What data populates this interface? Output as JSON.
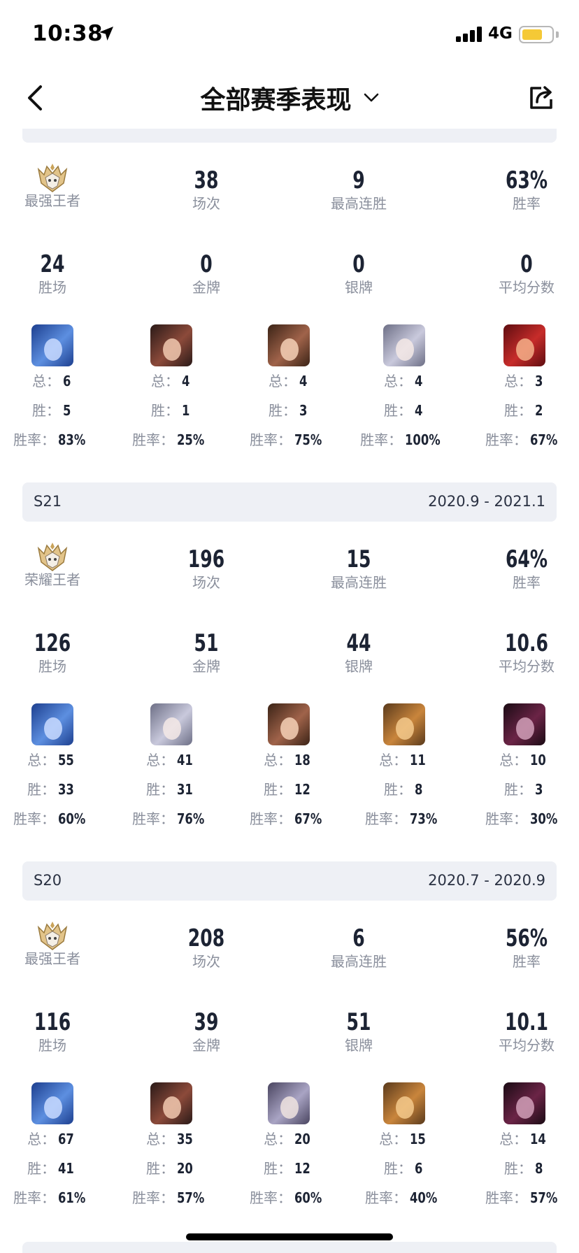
{
  "status_bar": {
    "time": "10:38",
    "network": "4G",
    "battery_level": 0.7
  },
  "nav": {
    "title": "全部赛季表现"
  },
  "seasons": [
    {
      "header": null,
      "rank_label": "最强王者",
      "matches": "38",
      "matches_label": "场次",
      "streak": "9",
      "streak_label": "最高连胜",
      "win_rate": "63%",
      "win_rate_label": "胜率",
      "wins": "24",
      "wins_label": "胜场",
      "gold": "0",
      "gold_label": "金牌",
      "silver": "0",
      "silver_label": "银牌",
      "avg_score": "0",
      "avg_score_label": "平均分数",
      "heroes": [
        {
          "avatar": "blue-hero",
          "total": "6",
          "wins": "5",
          "rate": "83%"
        },
        {
          "avatar": "dark-hair-hero",
          "total": "4",
          "wins": "1",
          "rate": "25%"
        },
        {
          "avatar": "brown-hair-hero",
          "total": "4",
          "wins": "3",
          "rate": "75%"
        },
        {
          "avatar": "silver-hair-hero",
          "total": "4",
          "wins": "4",
          "rate": "100%"
        },
        {
          "avatar": "red-hair-hero",
          "total": "3",
          "wins": "2",
          "rate": "67%"
        }
      ]
    },
    {
      "header": {
        "name": "S21",
        "range": "2020.9 - 2021.1"
      },
      "rank_label": "荣耀王者",
      "matches": "196",
      "matches_label": "场次",
      "streak": "15",
      "streak_label": "最高连胜",
      "win_rate": "64%",
      "win_rate_label": "胜率",
      "wins": "126",
      "wins_label": "胜场",
      "gold": "51",
      "gold_label": "金牌",
      "silver": "44",
      "silver_label": "银牌",
      "avg_score": "10.6",
      "avg_score_label": "平均分数",
      "heroes": [
        {
          "avatar": "blue-hero",
          "total": "55",
          "wins": "33",
          "rate": "60%"
        },
        {
          "avatar": "silver-hair-hero",
          "total": "41",
          "wins": "31",
          "rate": "76%"
        },
        {
          "avatar": "brown-hair-hero",
          "total": "18",
          "wins": "12",
          "rate": "67%"
        },
        {
          "avatar": "goggles-hero",
          "total": "11",
          "wins": "8",
          "rate": "73%"
        },
        {
          "avatar": "demon-hero",
          "total": "10",
          "wins": "3",
          "rate": "30%"
        }
      ]
    },
    {
      "header": {
        "name": "S20",
        "range": "2020.7 - 2020.9"
      },
      "rank_label": "最强王者",
      "matches": "208",
      "matches_label": "场次",
      "streak": "6",
      "streak_label": "最高连胜",
      "win_rate": "56%",
      "win_rate_label": "胜率",
      "wins": "116",
      "wins_label": "胜场",
      "gold": "39",
      "gold_label": "金牌",
      "silver": "51",
      "silver_label": "银牌",
      "avg_score": "10.1",
      "avg_score_label": "平均分数",
      "heroes": [
        {
          "avatar": "blue-hero",
          "total": "67",
          "wins": "41",
          "rate": "61%"
        },
        {
          "avatar": "dark-hair-hero",
          "total": "35",
          "wins": "20",
          "rate": "57%"
        },
        {
          "avatar": "lavender-hair-hero",
          "total": "20",
          "wins": "12",
          "rate": "60%"
        },
        {
          "avatar": "goggles-hero",
          "total": "15",
          "wins": "6",
          "rate": "40%"
        },
        {
          "avatar": "demon-hero",
          "total": "14",
          "wins": "8",
          "rate": "57%"
        }
      ]
    }
  ],
  "hero_labels": {
    "total": "总：",
    "wins": "胜：",
    "rate": "胜率："
  },
  "avatar_colors": {
    "blue-hero": [
      "#1d3f8f",
      "#5d8fe0",
      "#c9dbff"
    ],
    "dark-hair-hero": [
      "#2a1a18",
      "#8c4a3a",
      "#f1c9b0"
    ],
    "brown-hair-hero": [
      "#3b2316",
      "#a0634a",
      "#f4d0b6"
    ],
    "silver-hair-hero": [
      "#6d6f86",
      "#c9c9dc",
      "#f4e9e6"
    ],
    "red-hair-hero": [
      "#5e0d10",
      "#c72c2a",
      "#f5b08a"
    ],
    "goggles-hero": [
      "#5a3a1c",
      "#c9853c",
      "#f3c98c"
    ],
    "demon-hero": [
      "#1a0b14",
      "#6b2446",
      "#d1a0b8"
    ],
    "lavender-hair-hero": [
      "#4a4560",
      "#a9a4c4",
      "#efe3df"
    ]
  }
}
